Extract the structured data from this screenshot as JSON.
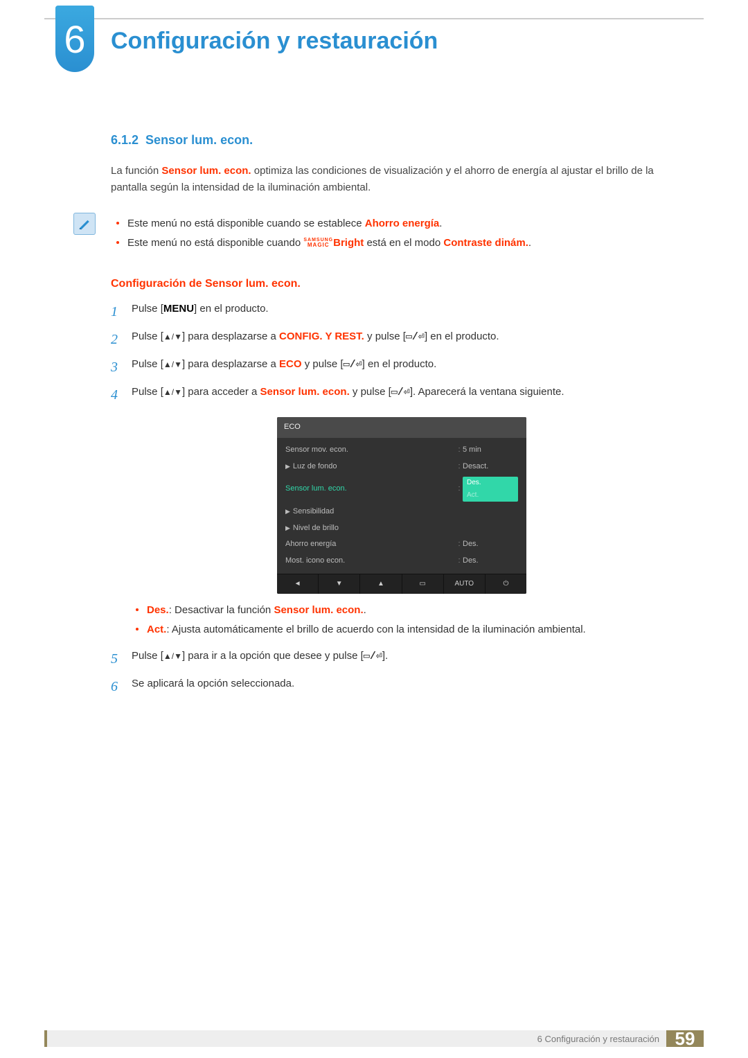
{
  "chapter": {
    "number": "6",
    "title": "Configuración y restauración"
  },
  "section": {
    "number": "6.1.2",
    "title": "Sensor lum. econ."
  },
  "intro": {
    "pre": "La función ",
    "hl": "Sensor lum. econ.",
    "post": " optimiza las condiciones de visualización y el ahorro de energía al ajustar el brillo de la pantalla según la intensidad de la iluminación ambiental."
  },
  "notes": {
    "n1_pre": "Este menú no está disponible cuando se establece ",
    "n1_hl": "Ahorro energía",
    "n1_post": ".",
    "n2_pre": "Este menú no está disponible cuando ",
    "n2_magic_top": "SAMSUNG",
    "n2_magic_bottom": "MAGIC",
    "n2_bright": "Bright",
    "n2_mid": " está en el modo ",
    "n2_hl": "Contraste dinám.",
    "n2_post": "."
  },
  "subheading": "Configuración de Sensor lum. econ.",
  "steps": {
    "s1": {
      "num": "1",
      "pre": "Pulse [",
      "key": "MENU",
      "post": "] en el producto."
    },
    "s2": {
      "num": "2",
      "pre": "Pulse [",
      "arrows": "▲/▼",
      "mid1": "] para desplazarse a ",
      "hl": "CONFIG. Y REST.",
      "mid2": " y pulse [",
      "icons": "▭/⏎",
      "post": "] en el producto."
    },
    "s3": {
      "num": "3",
      "pre": "Pulse [",
      "arrows": "▲/▼",
      "mid1": "] para desplazarse a ",
      "hl": "ECO",
      "mid2": " y pulse [",
      "icons": "▭/⏎",
      "post": "] en el producto."
    },
    "s4": {
      "num": "4",
      "pre": "Pulse [",
      "arrows": "▲/▼",
      "mid1": "] para acceder a ",
      "hl": "Sensor lum. econ.",
      "mid2": " y pulse [",
      "icons": "▭/⏎",
      "post": "]. Aparecerá la ventana siguiente."
    },
    "s5": {
      "num": "5",
      "pre": "Pulse [",
      "arrows": "▲/▼",
      "mid1": "] para ir a la opción que desee y pulse [",
      "icons": "▭/⏎",
      "post": "]."
    },
    "s6": {
      "num": "6",
      "text": "Se aplicará la opción seleccionada."
    }
  },
  "osd": {
    "title": "ECO",
    "rows": {
      "r1": {
        "label": "Sensor mov. econ.",
        "value": "5 min"
      },
      "r2": {
        "label": "Luz de fondo",
        "value": "Desact.",
        "sub": true
      },
      "r3": {
        "label": "Sensor lum. econ.",
        "active": true,
        "opt1": "Des.",
        "opt2": "Act."
      },
      "r4": {
        "label": "Sensibilidad",
        "sub": true
      },
      "r5": {
        "label": "Nivel de brillo",
        "sub": true
      },
      "r6": {
        "label": "Ahorro energía",
        "value": "Des."
      },
      "r7": {
        "label": "Most. icono econ.",
        "value": "Des."
      }
    },
    "footer": {
      "f1": "◄",
      "f2": "▼",
      "f3": "▲",
      "f4": "▭",
      "f5": "AUTO",
      "f6": "⏻"
    }
  },
  "option_desc": {
    "des_label": "Des.",
    "des_mid": ": Desactivar la función ",
    "des_hl": "Sensor lum. econ.",
    "des_post": ".",
    "act_label": "Act.",
    "act_text": ": Ajusta automáticamente el brillo de acuerdo con la intensidad de la iluminación ambiental."
  },
  "footer": {
    "text": "6 Configuración y restauración",
    "page": "59"
  }
}
